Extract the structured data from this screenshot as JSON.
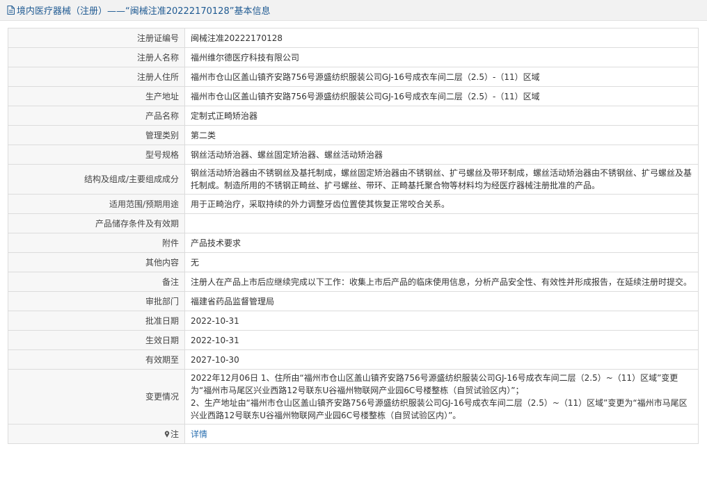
{
  "header": {
    "title": "境内医疗器械（注册）——“闽械注准20222170128”基本信息"
  },
  "rows": [
    {
      "label": "注册证编号",
      "value": "闽械注准20222170128"
    },
    {
      "label": "注册人名称",
      "value": "福州维尔德医疗科技有限公司"
    },
    {
      "label": "注册人住所",
      "value": "福州市仓山区盖山镇齐安路756号源盛纺织服装公司GJ-16号成衣车间二层（2.5）-（11）区域"
    },
    {
      "label": "生产地址",
      "value": "福州市仓山区盖山镇齐安路756号源盛纺织服装公司GJ-16号成衣车间二层（2.5）-（11）区域"
    },
    {
      "label": "产品名称",
      "value": "定制式正畸矫治器"
    },
    {
      "label": "管理类别",
      "value": "第二类"
    },
    {
      "label": "型号规格",
      "value": "钢丝活动矫治器、螺丝固定矫治器、螺丝活动矫治器"
    },
    {
      "label": "结构及组成/主要组成成分",
      "value": "钢丝活动矫治器由不锈钢丝及基托制成，螺丝固定矫治器由不锈钢丝、扩弓螺丝及带环制成，螺丝活动矫治器由不锈钢丝、扩弓螺丝及基托制成。制造所用的不锈钢正畸丝、扩弓螺丝、带环、正畸基托聚合物等材料均为经医疗器械注册批准的产品。"
    },
    {
      "label": "适用范围/预期用途",
      "value": "用于正畸治疗，采取持续的外力调整牙齿位置使其恢复正常咬合关系。"
    },
    {
      "label": "产品储存条件及有效期",
      "value": ""
    },
    {
      "label": "附件",
      "value": "产品技术要求"
    },
    {
      "label": "其他内容",
      "value": "无"
    },
    {
      "label": "备注",
      "value": "注册人在产品上市后应继续完成以下工作：收集上市后产品的临床使用信息，分析产品安全性、有效性并形成报告，在延续注册时提交。"
    },
    {
      "label": "审批部门",
      "value": "福建省药品监督管理局"
    },
    {
      "label": "批准日期",
      "value": "2022-10-31"
    },
    {
      "label": "生效日期",
      "value": "2022-10-31"
    },
    {
      "label": "有效期至",
      "value": "2027-10-30"
    }
  ],
  "change": {
    "label": "变更情况",
    "line1": "2022年12月06日 1、住所由“福州市仓山区盖山镇齐安路756号源盛纺织服装公司GJ-16号成衣车间二层（2.5）~（11）区域”变更为“福州市马尾区兴业西路12号联东U谷福州物联网产业园6C号楼整栋（自贸试验区内）”；",
    "line2": "2、生产地址由“福州市仓山区盖山镇齐安路756号源盛纺织服装公司GJ-16号成衣车间二层（2.5）~（11）区域”变更为“福州市马尾区兴业西路12号联东U谷福州物联网产业园6C号楼整栋（自贸试验区内）”。"
  },
  "note": {
    "label": "注",
    "link_text": "详情",
    "icon": "pin-icon"
  },
  "colors": {
    "title": "#1f5a92",
    "link": "#2a6fb0",
    "label_bg": "#f7f7f7",
    "border": "#dcdcdc"
  }
}
